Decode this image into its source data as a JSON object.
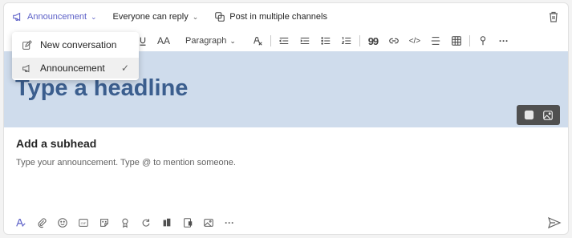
{
  "topbar": {
    "post_type": "Announcement",
    "reply_setting": "Everyone can reply",
    "multi_channel": "Post in multiple channels"
  },
  "toolbar": {
    "font_size_glyph": "AA",
    "paragraph": "Paragraph",
    "quote_glyph": "99",
    "code_glyph": "</>",
    "more_glyph": "···"
  },
  "dropdown": {
    "items": [
      {
        "label": "New conversation",
        "icon": "compose-icon"
      },
      {
        "label": "Announcement",
        "icon": "megaphone-icon",
        "selected": true,
        "check": "✓"
      }
    ]
  },
  "banner": {
    "headline": "Type a headline"
  },
  "editor": {
    "subhead": "Add a subhead",
    "placeholder": "Type your announcement. Type @ to mention someone."
  },
  "bottombar": {
    "gif_label": "GIF",
    "more_glyph": "···"
  },
  "colors": {
    "accent": "#5b5fc7",
    "banner": "#cfdcec",
    "headline": "#3b5e8e"
  }
}
